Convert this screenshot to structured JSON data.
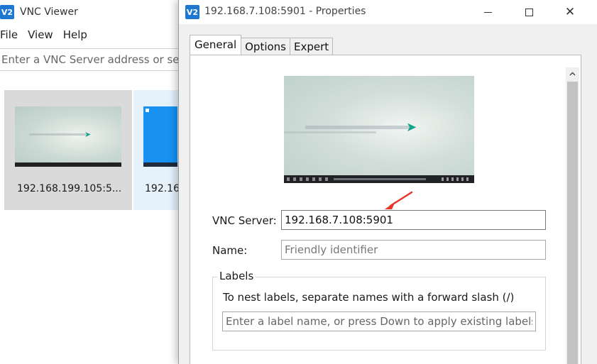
{
  "main_window": {
    "logo_text": "V2",
    "title": "VNC Viewer",
    "menu": [
      "File",
      "View",
      "Help"
    ],
    "address_placeholder": "Enter a VNC Server address or sear",
    "tiles": [
      {
        "label": "192.168.199.105:5..."
      },
      {
        "label": "192.16"
      }
    ]
  },
  "dialog": {
    "logo_text": "V2",
    "title": "192.168.7.108:5901 - Properties",
    "tabs": [
      {
        "label": "General",
        "active": true
      },
      {
        "label": "Options",
        "active": false
      },
      {
        "label": "Expert",
        "active": false
      }
    ],
    "vnc_server": {
      "label": "VNC Server:",
      "value": "192.168.7.108:5901"
    },
    "name": {
      "label": "Name:",
      "placeholder": "Friendly identifier"
    },
    "labels": {
      "legend": "Labels",
      "hint": "To nest labels, separate names with a forward slash (/)",
      "placeholder": "Enter a label name, or press Down to apply existing labels"
    }
  },
  "colors": {
    "accent": "#1e78d2",
    "arrow": "#e8352a",
    "selected_tile": "#dadada",
    "hover_tile": "#e5f1fb"
  }
}
